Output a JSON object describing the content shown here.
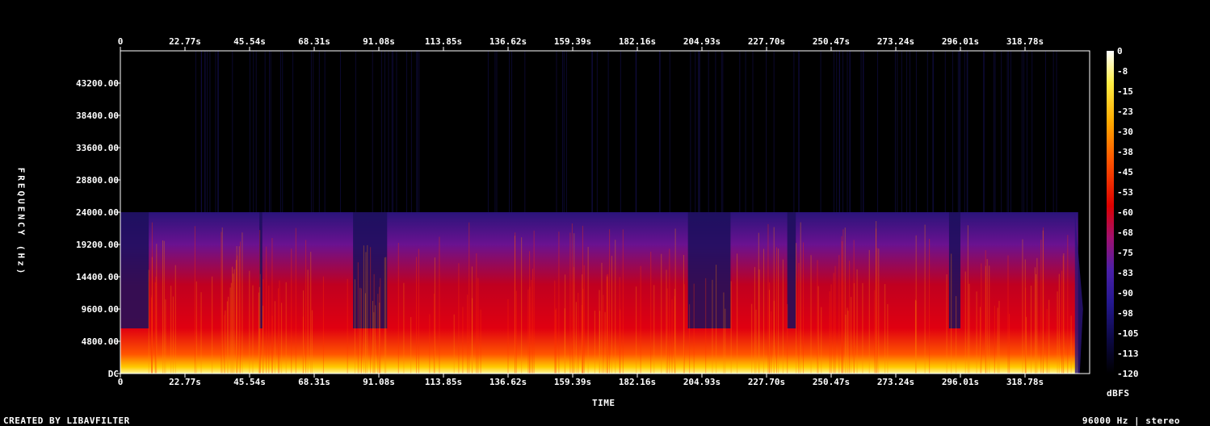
{
  "chart_data": {
    "type": "heatmap",
    "xlabel": "TIME",
    "ylabel": "FREQUENCY (Hz)",
    "x_ticks": [
      "0",
      "22.77s",
      "45.54s",
      "68.31s",
      "91.08s",
      "113.85s",
      "136.62s",
      "159.39s",
      "182.16s",
      "204.93s",
      "227.70s",
      "250.47s",
      "273.24s",
      "296.01s",
      "318.78s"
    ],
    "x_tick_values": [
      0,
      22.77,
      45.54,
      68.31,
      91.08,
      113.85,
      136.62,
      159.39,
      182.16,
      204.93,
      227.7,
      250.47,
      273.24,
      296.01,
      318.78
    ],
    "xlim": [
      0,
      341.55
    ],
    "y_ticks": [
      "DC",
      "4800.00",
      "9600.00",
      "14400.00",
      "19200.00",
      "24000.00",
      "28800.00",
      "33600.00",
      "38400.00",
      "43200.00"
    ],
    "y_tick_values": [
      0,
      4800,
      9600,
      14400,
      19200,
      24000,
      28800,
      33600,
      38400,
      43200
    ],
    "ylim": [
      0,
      48000
    ],
    "content_cutoff_hz": 24000,
    "audio_end_s": 337.5,
    "quiet_segments_s": [
      [
        0,
        10
      ],
      [
        49,
        50
      ],
      [
        82,
        94
      ],
      [
        200,
        215
      ],
      [
        235,
        238
      ],
      [
        292,
        296
      ]
    ],
    "colorbar": {
      "unit": "dBFS",
      "ticks": [
        "0",
        "-8",
        "-15",
        "-23",
        "-30",
        "-38",
        "-45",
        "-53",
        "-60",
        "-68",
        "-75",
        "-83",
        "-90",
        "-98",
        "-105",
        "-113",
        "-120"
      ],
      "range": [
        -120,
        0
      ],
      "colors": [
        "#000000",
        "#0b0840",
        "#241890",
        "#4a1fa8",
        "#a01070",
        "#dd0000",
        "#ff5500",
        "#ffaa00",
        "#ffee44",
        "#ffffff"
      ]
    }
  },
  "footer": {
    "left": "CREATED BY LIBAVFILTER",
    "right": "96000 Hz | stereo"
  }
}
